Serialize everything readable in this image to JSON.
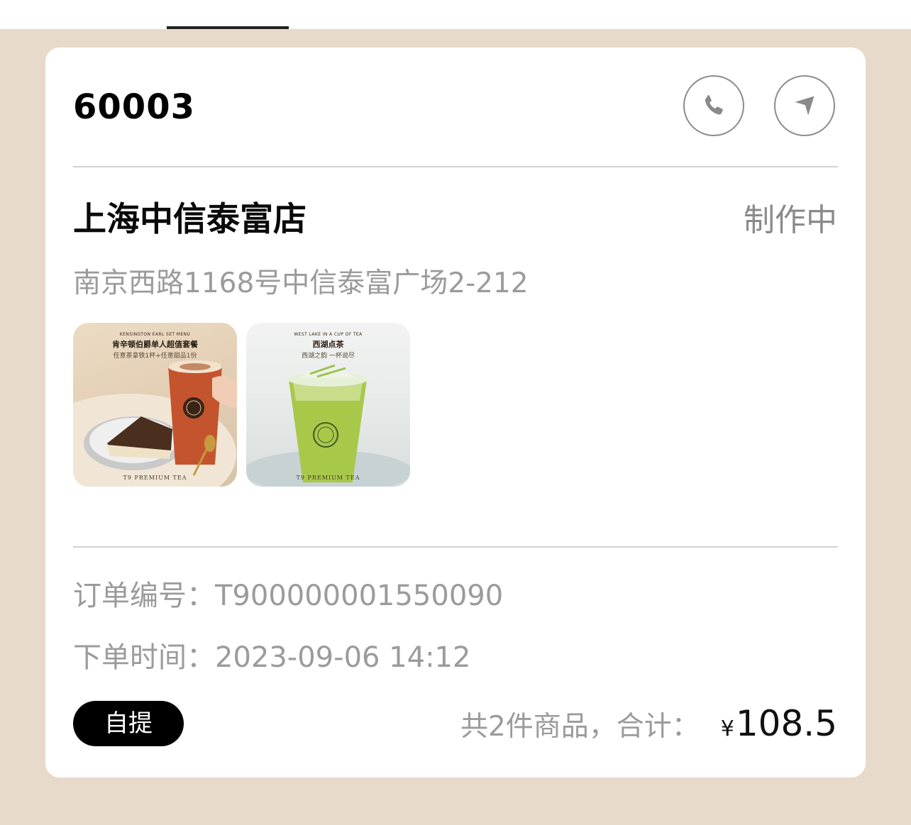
{
  "order": {
    "code": "60003",
    "store_name": "上海中信泰富店",
    "status": "制作中",
    "address": "南京西路1168号中信泰富广场2-212",
    "order_number_label": "订单编号：",
    "order_number": "T900000001550090",
    "order_time_label": "下单时间：",
    "order_time": "2023-09-06 14:12",
    "pickup_mode": "自提",
    "summary_text": "共2件商品，合计：",
    "currency_symbol": "¥",
    "total": "108.5"
  },
  "products": [
    {
      "title_en": "KENSINGTON EARL SET MENU",
      "title_cn": "肯辛顿伯爵单人超值套餐",
      "subtitle": "任意茶拿铁1杯+任意甜品1份",
      "footer": "T9 PREMIUM TEA"
    },
    {
      "title_en": "WEST LAKE IN A CUP OF TEA",
      "title_cn": "西湖点茶",
      "subtitle": "西湖之韵 一杯说尽",
      "footer": "T9 PREMIUM TEA"
    }
  ],
  "icons": {
    "call": "phone-icon",
    "navigate": "navigation-arrow-icon"
  },
  "colors": {
    "background": "#e8dacb",
    "card": "#ffffff",
    "muted_text": "#9b9b9b",
    "badge": "#000000"
  }
}
